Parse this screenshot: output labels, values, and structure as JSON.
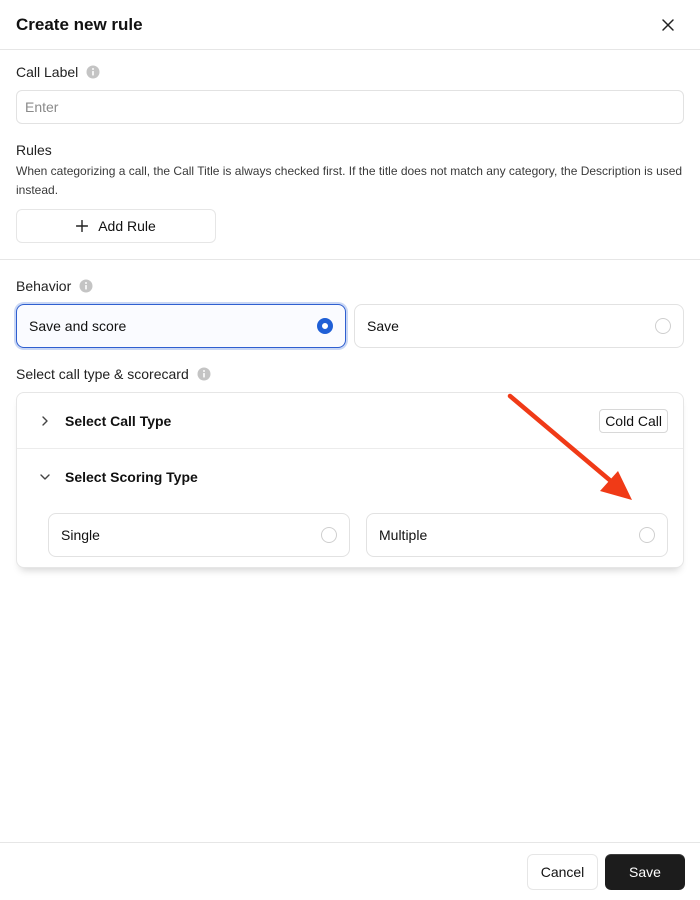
{
  "dialog": {
    "title": "Create new rule"
  },
  "call_label": {
    "label": "Call Label",
    "placeholder": "Enter",
    "value": ""
  },
  "rules": {
    "label": "Rules",
    "description": "When categorizing a call, the Call Title is always checked first. If the title does not match any category, the Description is used instead.",
    "add_rule_label": "Add Rule"
  },
  "behavior": {
    "label": "Behavior",
    "options": [
      {
        "label": "Save and score",
        "selected": true
      },
      {
        "label": "Save",
        "selected": false
      }
    ]
  },
  "call_type_section": {
    "label": "Select call type & scorecard",
    "call_type": {
      "title": "Select Call Type",
      "selected_value": "Cold Call",
      "expanded": false
    },
    "scoring_type": {
      "title": "Select Scoring Type",
      "expanded": true,
      "options": [
        {
          "label": "Single",
          "selected": false
        },
        {
          "label": "Multiple",
          "selected": false
        }
      ]
    }
  },
  "footer": {
    "cancel_label": "Cancel",
    "save_label": "Save"
  },
  "colors": {
    "accent": "#1f5fd6",
    "primary_button": "#1c1c1c",
    "annotation_arrow": "#f03a17"
  },
  "icons": {
    "close": "close-icon",
    "info": "info-icon",
    "plus": "plus-icon",
    "chevron_right": "chevron-right-icon",
    "chevron_down": "chevron-down-icon",
    "arrow": "annotation-arrow"
  }
}
